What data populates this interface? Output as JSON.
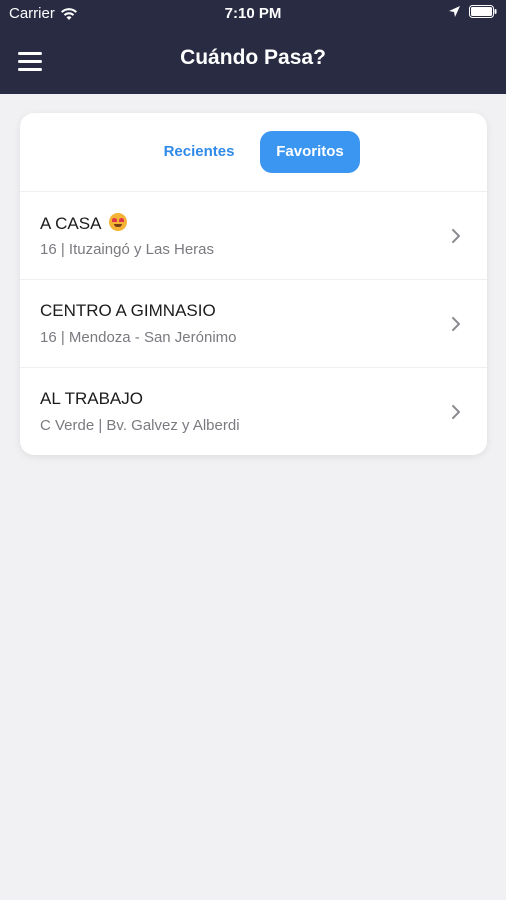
{
  "status_bar": {
    "carrier": "Carrier",
    "time": "7:10 PM"
  },
  "nav": {
    "title": "Cuándo Pasa?"
  },
  "tabs": {
    "recientes": "Recientes",
    "favoritos": "Favoritos",
    "active": "favoritos"
  },
  "favorites": [
    {
      "title": "A CASA",
      "subtitle": "16 | Ituzaingó y Las Heras",
      "emoji": "heart-eyes-emoji"
    },
    {
      "title": "CENTRO A GIMNASIO",
      "subtitle": "16 | Mendoza - San Jerónimo"
    },
    {
      "title": "AL TRABAJO",
      "subtitle": "C Verde | Bv. Galvez y Alberdi"
    }
  ],
  "colors": {
    "header": "#282b42",
    "accent": "#3b96f2",
    "background": "#f1f1f3"
  }
}
